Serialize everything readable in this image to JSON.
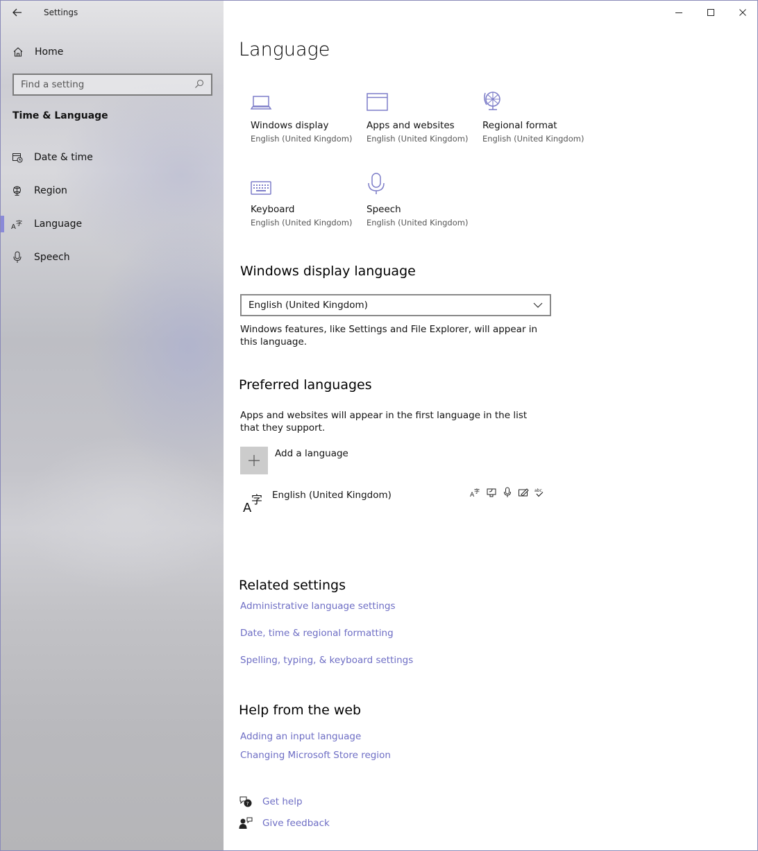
{
  "window": {
    "app_title": "Settings"
  },
  "sidebar": {
    "home_label": "Home",
    "search_placeholder": "Find a setting",
    "section_heading": "Time & Language",
    "items": [
      {
        "label": "Date & time",
        "icon": "calendar-clock-icon"
      },
      {
        "label": "Region",
        "icon": "globe-icon"
      },
      {
        "label": "Language",
        "icon": "language-icon",
        "selected": true
      },
      {
        "label": "Speech",
        "icon": "microphone-icon"
      }
    ]
  },
  "main": {
    "page_title": "Language",
    "tiles": [
      {
        "title": "Windows display",
        "subtitle": "English (United Kingdom)",
        "icon": "laptop-icon"
      },
      {
        "title": "Apps and websites",
        "subtitle": "English (United Kingdom)",
        "icon": "browser-window-icon"
      },
      {
        "title": "Regional format",
        "subtitle": "English (United Kingdom)",
        "icon": "regional-globe-icon"
      },
      {
        "title": "Keyboard",
        "subtitle": "English (United Kingdom)",
        "icon": "keyboard-icon"
      },
      {
        "title": "Speech",
        "subtitle": "English (United Kingdom)",
        "icon": "microphone-icon"
      }
    ],
    "display_language": {
      "heading": "Windows display language",
      "selected": "English (United Kingdom)",
      "description": "Windows features, like Settings and File Explorer, will appear in this language."
    },
    "preferred": {
      "heading": "Preferred languages",
      "description": "Apps and websites will appear in the first language in the list that they support.",
      "add_label": "Add a language",
      "languages": [
        {
          "name": "English (United Kingdom)"
        }
      ]
    },
    "related": {
      "heading": "Related settings",
      "links": [
        "Administrative language settings",
        "Date, time & regional formatting",
        "Spelling, typing, & keyboard settings"
      ]
    },
    "help": {
      "heading": "Help from the web",
      "links": [
        "Adding an input language",
        "Changing Microsoft Store region"
      ],
      "get_help": "Get help",
      "give_feedback": "Give feedback"
    }
  },
  "colors": {
    "accent": "#8a8ad8",
    "link": "#6d6dc4",
    "icon": "#7c7cc8"
  }
}
